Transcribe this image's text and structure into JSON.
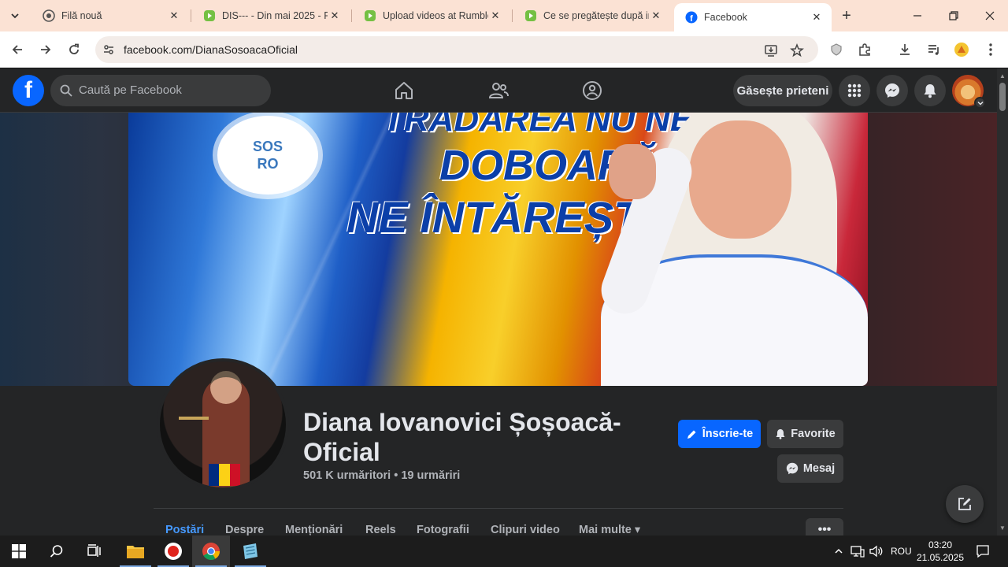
{
  "browser": {
    "tabs": [
      {
        "title": "Filă nouă",
        "favicon": "chrome-icon"
      },
      {
        "title": "DIS--- - Din mai 2025 - P",
        "favicon": "rumble-icon"
      },
      {
        "title": "Upload videos at Rumble",
        "favicon": "rumble-icon"
      },
      {
        "title": "Ce se pregătește după in",
        "favicon": "rumble-icon"
      },
      {
        "title": "Facebook",
        "favicon": "facebook-icon"
      }
    ],
    "url": "facebook.com/DianaSosoacaOficial",
    "accent": "#fbe2d4"
  },
  "fb": {
    "logo_letter": "f",
    "search_placeholder": "Caută pe Facebook",
    "find_friends": "Găsește prieteni",
    "brand_color": "#0866ff"
  },
  "cover": {
    "logo_line1": "SOS",
    "logo_line2": "RO",
    "slogan_line1": "TRĂDAREA NU NE",
    "slogan_line2": "DOBOARĂ",
    "slogan_line3": "NE ÎNTĂREȘTE!"
  },
  "profile": {
    "name": "Diana Iovanovici Șoșoacă-Oficial",
    "stats": "501 K urmăritori • 19 urmăriri",
    "join_button": "Înscrie-te",
    "favorites_button": "Favorite",
    "message_button": "Mesaj",
    "more_button": "•••"
  },
  "page_tabs": [
    {
      "label": "Postări",
      "active": true
    },
    {
      "label": "Despre",
      "active": false
    },
    {
      "label": "Menționări",
      "active": false
    },
    {
      "label": "Reels",
      "active": false
    },
    {
      "label": "Fotografii",
      "active": false
    },
    {
      "label": "Clipuri video",
      "active": false
    },
    {
      "label": "Mai multe ▾",
      "active": false
    }
  ],
  "taskbar": {
    "language": "ROU",
    "time": "03:20",
    "date": "21.05.2025"
  }
}
